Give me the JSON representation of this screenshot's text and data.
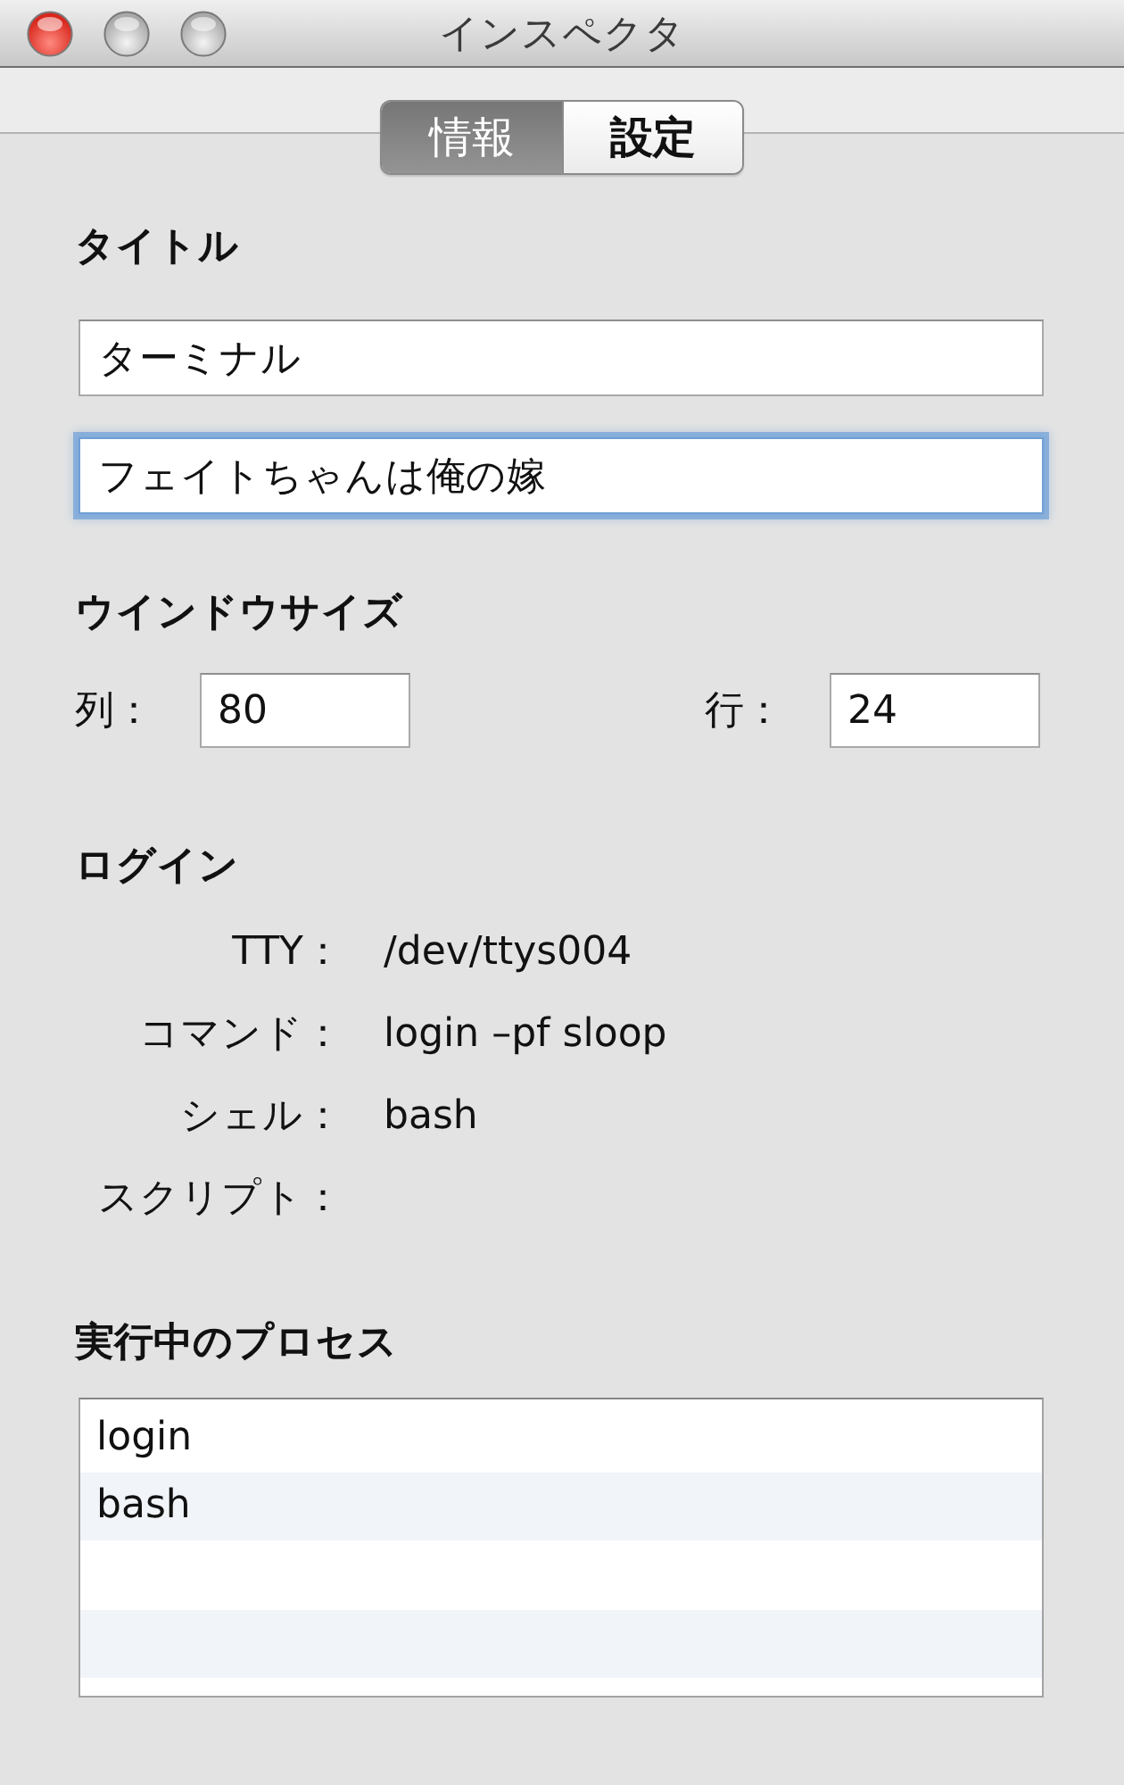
{
  "window": {
    "title": "インスペクタ",
    "controls": [
      {
        "kind": "close",
        "disabled": false
      },
      {
        "kind": "minimize",
        "disabled": true
      },
      {
        "kind": "zoom",
        "disabled": true
      }
    ]
  },
  "tabs": [
    {
      "label": "情報",
      "selected": true
    },
    {
      "label": "設定",
      "selected": false
    }
  ],
  "title_section": {
    "heading": "タイトル",
    "fields": [
      {
        "value": "ターミナル",
        "focused": false
      },
      {
        "value": "フェイトちゃんは俺の嫁",
        "focused": true
      }
    ]
  },
  "window_size": {
    "heading": "ウインドウサイズ",
    "fields": [
      {
        "label": "列：",
        "value": "80"
      },
      {
        "label": "行：",
        "value": "24"
      }
    ]
  },
  "login": {
    "heading": "ログイン",
    "rows": [
      {
        "label": "TTY：",
        "value": "/dev/ttys004"
      },
      {
        "label": "コマンド：",
        "value": "login –pf sloop"
      },
      {
        "label": "シェル：",
        "value": "bash"
      },
      {
        "label": "スクリプト："
      }
    ]
  },
  "processes": {
    "heading": "実行中のプロセス",
    "rows": [
      "login",
      "bash"
    ]
  }
}
